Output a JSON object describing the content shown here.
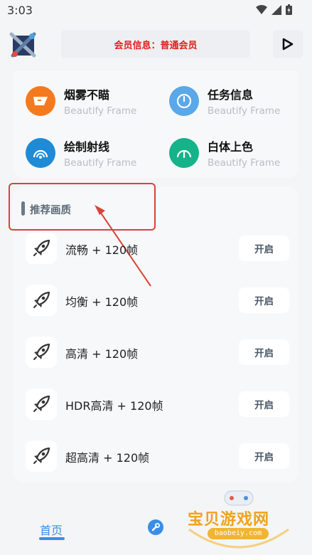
{
  "status": {
    "time": "3:03"
  },
  "header": {
    "member_info": "会员信息：普通会员"
  },
  "features": [
    {
      "title": "烟雾不瞄",
      "subtitle": "Beautify Frame",
      "color": "#f57a1e",
      "icon": "smoke-icon"
    },
    {
      "title": "任务信息",
      "subtitle": "Beautify Frame",
      "color": "#5aa8e8",
      "icon": "gauge-icon"
    },
    {
      "title": "绘制射线",
      "subtitle": "Beautify Frame",
      "color": "#1f8bd6",
      "icon": "gauge-icon"
    },
    {
      "title": "白体上色",
      "subtitle": "Beautify Frame",
      "color": "#14b38a",
      "icon": "gauge-icon"
    }
  ],
  "section": {
    "title": "推荐画质"
  },
  "presets": [
    {
      "label": "流畅 + 120帧",
      "button": "开启",
      "icon": "rocket-icon"
    },
    {
      "label": "均衡 + 120帧",
      "button": "开启",
      "icon": "rocket-icon"
    },
    {
      "label": "高清 + 120帧",
      "button": "开启",
      "icon": "rocket-icon"
    },
    {
      "label": "HDR高清 + 120帧",
      "button": "开启",
      "icon": "rocket-icon"
    },
    {
      "label": "超高清 + 120帧",
      "button": "开启",
      "icon": "rocket-icon"
    }
  ],
  "nav": {
    "home": "首页",
    "tool_icon": "wrench-icon"
  },
  "watermark": {
    "text": "宝贝游戏网",
    "url": "baobeiy.com"
  },
  "colors": {
    "accent": "#3a8ee6",
    "member_text": "#e0201c",
    "highlight": "#d9433a"
  }
}
